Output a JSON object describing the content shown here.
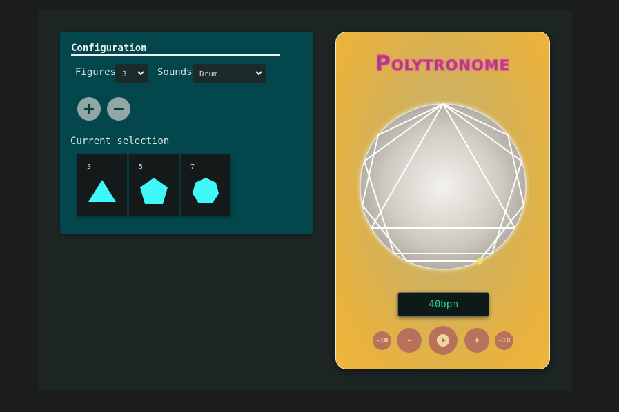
{
  "config": {
    "title": "Configuration",
    "figures_label": "Figures",
    "figures_value": "3",
    "sounds_label": "Sounds",
    "sounds_value": "Drum",
    "add_label": "+",
    "remove_label": "−",
    "selection_label": "Current selection",
    "selection": [
      {
        "sides": "3",
        "shape": "triangle"
      },
      {
        "sides": "5",
        "shape": "pentagon"
      },
      {
        "sides": "7",
        "shape": "heptagon"
      }
    ]
  },
  "device": {
    "title": "Polytronome",
    "bpm": "40bpm",
    "controls": {
      "minus10": "-10",
      "minus1": "-",
      "play_icon": "play-icon",
      "plus1": "+",
      "plus10": "+10"
    }
  },
  "colors": {
    "shape_fill": "#3ff8f8",
    "panel": "#03464b",
    "device_gold": "#f0b43a",
    "title_pink": "#e8479c",
    "bpm_green": "#33d28d"
  }
}
